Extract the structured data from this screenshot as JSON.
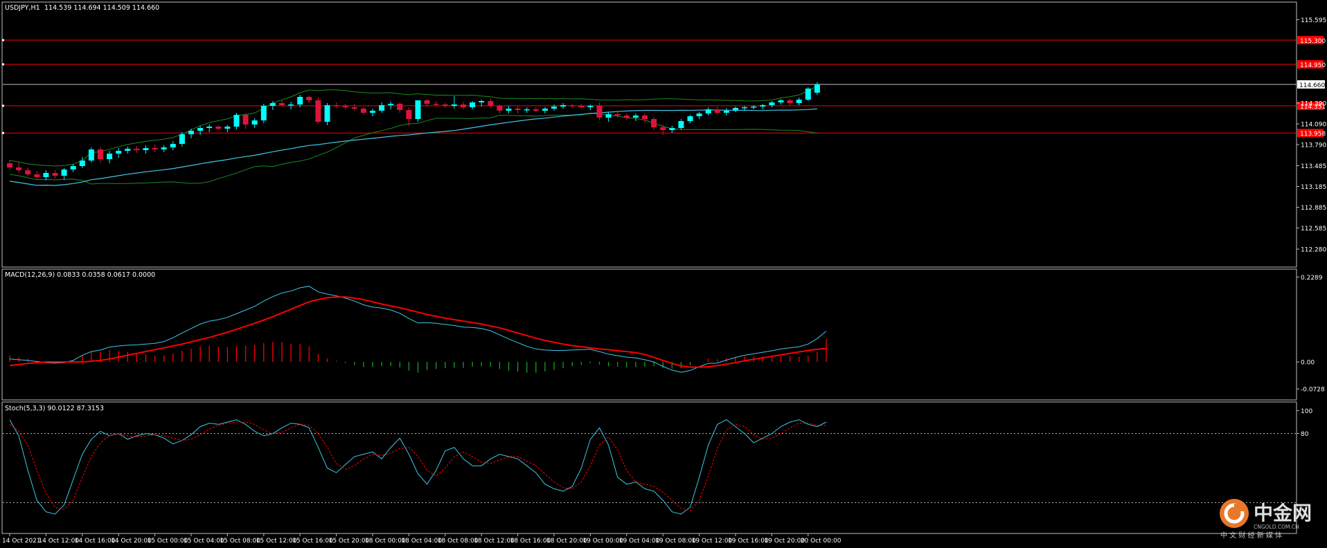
{
  "header": {
    "symbol_label": "USDJPY,H1",
    "ohlc_label": "114.539 114.694 114.509 114.660"
  },
  "colors": {
    "background": "#000000",
    "frame": "#c0c0c0",
    "bull_candle": "#00ffff",
    "bear_candle": "#dc143c",
    "moving_average": "#40c8e8",
    "bollinger_band": "#1e8c1e",
    "level_line": "#ff0000",
    "price_line": "#c0c0c0",
    "macd_line": "#40c8e8",
    "signal_line": "#ff0000",
    "hist_positive": "#ff0000",
    "hist_negative": "#1ea01e",
    "stoch_main": "#40c8e8",
    "stoch_signal": "#ff0000",
    "text": "#ffffff"
  },
  "chart_data": [
    {
      "type": "candlestick",
      "name": "USDJPY,H1",
      "ylim": [
        112.1,
        115.78
      ],
      "y_ticks": [
        "115.595",
        "114.390",
        "114.090",
        "113.790",
        "113.485",
        "113.185",
        "112.885",
        "112.585",
        "112.280"
      ],
      "current_price_label": "114.660",
      "current_price": 114.66,
      "level_labels": [
        "115.300",
        "114.950",
        "114.351",
        "113.958"
      ],
      "levels": [
        115.3,
        114.95,
        114.351,
        113.958
      ],
      "x_labels": [
        "14 Oct 2021",
        "14 Oct 12:00",
        "14 Oct 16:00",
        "14 Oct 20:00",
        "15 Oct 00:00",
        "15 Oct 04:00",
        "15 Oct 08:00",
        "15 Oct 12:00",
        "15 Oct 16:00",
        "15 Oct 20:00",
        "18 Oct 00:00",
        "18 Oct 04:00",
        "18 Oct 08:00",
        "18 Oct 12:00",
        "18 Oct 16:00",
        "18 Oct 20:00",
        "19 Oct 00:00",
        "19 Oct 04:00",
        "19 Oct 08:00",
        "19 Oct 12:00",
        "19 Oct 16:00",
        "19 Oct 20:00",
        "20 Oct 00:00"
      ],
      "candles": [
        [
          113.52,
          113.57,
          113.43,
          113.46
        ],
        [
          113.46,
          113.53,
          113.38,
          113.42
        ],
        [
          113.42,
          113.46,
          113.33,
          113.36
        ],
        [
          113.36,
          113.41,
          113.29,
          113.32
        ],
        [
          113.32,
          113.42,
          113.27,
          113.38
        ],
        [
          113.38,
          113.42,
          113.3,
          113.34
        ],
        [
          113.34,
          113.45,
          113.28,
          113.43
        ],
        [
          113.43,
          113.51,
          113.39,
          113.48
        ],
        [
          113.48,
          113.61,
          113.45,
          113.56
        ],
        [
          113.56,
          113.75,
          113.53,
          113.72
        ],
        [
          113.72,
          113.76,
          113.53,
          113.58
        ],
        [
          113.58,
          113.7,
          113.52,
          113.66
        ],
        [
          113.66,
          113.74,
          113.6,
          113.7
        ],
        [
          113.7,
          113.76,
          113.66,
          113.73
        ],
        [
          113.73,
          113.77,
          113.67,
          113.71
        ],
        [
          113.71,
          113.78,
          113.66,
          113.74
        ],
        [
          113.74,
          113.79,
          113.68,
          113.72
        ],
        [
          113.72,
          113.78,
          113.68,
          113.75
        ],
        [
          113.75,
          113.84,
          113.71,
          113.8
        ],
        [
          113.8,
          113.97,
          113.76,
          113.94
        ],
        [
          113.94,
          114.02,
          113.88,
          113.99
        ],
        [
          113.99,
          114.06,
          113.93,
          114.03
        ],
        [
          114.03,
          114.08,
          113.97,
          114.05
        ],
        [
          114.05,
          114.07,
          114.0,
          114.02
        ],
        [
          114.02,
          114.07,
          113.97,
          114.05
        ],
        [
          114.05,
          114.25,
          114.01,
          114.22
        ],
        [
          114.22,
          114.24,
          114.02,
          114.08
        ],
        [
          114.08,
          114.17,
          114.03,
          114.14
        ],
        [
          114.14,
          114.38,
          114.1,
          114.35
        ],
        [
          114.35,
          114.42,
          114.29,
          114.39
        ],
        [
          114.39,
          114.43,
          114.34,
          114.36
        ],
        [
          114.36,
          114.41,
          114.3,
          114.37
        ],
        [
          114.37,
          114.51,
          114.33,
          114.48
        ],
        [
          114.48,
          114.5,
          114.39,
          114.43
        ],
        [
          114.43,
          114.47,
          114.09,
          114.12
        ],
        [
          114.12,
          114.39,
          114.07,
          114.36
        ],
        [
          114.36,
          114.4,
          114.32,
          114.35
        ],
        [
          114.35,
          114.38,
          114.3,
          114.33
        ],
        [
          114.33,
          114.38,
          114.28,
          114.31
        ],
        [
          114.31,
          114.33,
          114.22,
          114.25
        ],
        [
          114.25,
          114.31,
          114.2,
          114.28
        ],
        [
          114.28,
          114.4,
          114.25,
          114.36
        ],
        [
          114.36,
          114.41,
          114.3,
          114.38
        ],
        [
          114.38,
          114.4,
          114.25,
          114.29
        ],
        [
          114.29,
          114.33,
          114.06,
          114.16
        ],
        [
          114.16,
          114.34,
          114.12,
          114.43
        ],
        [
          114.43,
          114.45,
          114.34,
          114.38
        ],
        [
          114.38,
          114.42,
          114.34,
          114.37
        ],
        [
          114.37,
          114.4,
          114.32,
          114.35
        ],
        [
          114.35,
          114.49,
          114.31,
          114.37
        ],
        [
          114.37,
          114.41,
          114.3,
          114.33
        ],
        [
          114.33,
          114.42,
          114.3,
          114.4
        ],
        [
          114.4,
          114.44,
          114.34,
          114.42
        ],
        [
          114.42,
          114.46,
          114.33,
          114.35
        ],
        [
          114.35,
          114.37,
          114.24,
          114.28
        ],
        [
          114.28,
          114.35,
          114.24,
          114.31
        ],
        [
          114.31,
          114.34,
          114.24,
          114.29
        ],
        [
          114.29,
          114.33,
          114.25,
          114.3
        ],
        [
          114.3,
          114.33,
          114.26,
          114.28
        ],
        [
          114.28,
          114.33,
          114.24,
          114.31
        ],
        [
          114.31,
          114.37,
          114.28,
          114.34
        ],
        [
          114.34,
          114.39,
          114.31,
          114.36
        ],
        [
          114.36,
          114.38,
          114.32,
          114.35
        ],
        [
          114.35,
          114.38,
          114.31,
          114.33
        ],
        [
          114.33,
          114.37,
          114.29,
          114.35
        ],
        [
          114.35,
          114.4,
          114.14,
          114.18
        ],
        [
          114.18,
          114.26,
          114.12,
          114.23
        ],
        [
          114.23,
          114.26,
          114.18,
          114.21
        ],
        [
          114.21,
          114.24,
          114.15,
          114.18
        ],
        [
          114.18,
          114.24,
          114.13,
          114.21
        ],
        [
          114.21,
          114.24,
          114.1,
          114.16
        ],
        [
          114.16,
          114.19,
          114.0,
          114.04
        ],
        [
          114.04,
          114.08,
          113.93,
          114.0
        ],
        [
          114.0,
          114.06,
          113.96,
          114.03
        ],
        [
          114.03,
          114.16,
          114.0,
          114.13
        ],
        [
          114.13,
          114.22,
          114.1,
          114.2
        ],
        [
          114.2,
          114.26,
          114.16,
          114.24
        ],
        [
          114.24,
          114.33,
          114.21,
          114.3
        ],
        [
          114.3,
          114.34,
          114.22,
          114.25
        ],
        [
          114.25,
          114.32,
          114.21,
          114.28
        ],
        [
          114.28,
          114.34,
          114.26,
          114.32
        ],
        [
          114.32,
          114.35,
          114.28,
          114.33
        ],
        [
          114.33,
          114.36,
          114.3,
          114.34
        ],
        [
          114.34,
          114.38,
          114.3,
          114.36
        ],
        [
          114.36,
          114.42,
          114.33,
          114.4
        ],
        [
          114.4,
          114.45,
          114.37,
          114.43
        ],
        [
          114.43,
          114.45,
          114.36,
          114.39
        ],
        [
          114.39,
          114.47,
          114.36,
          114.44
        ],
        [
          114.44,
          114.62,
          114.42,
          114.6
        ],
        [
          114.54,
          114.694,
          114.509,
          114.66
        ]
      ]
    },
    {
      "type": "line",
      "name": "MACD(12,26,9)",
      "label": "MACD(12,26,9) 0.0833 0.0358 0.0617 0.0000",
      "ylim": [
        -0.095,
        0.2389
      ],
      "y_ticks": [
        "0.2289",
        "0.00",
        "-0.0728"
      ],
      "macd": [
        0.008,
        0.006,
        0.004,
        0.001,
        -0.002,
        -0.003,
        -0.002,
        0.004,
        0.018,
        0.028,
        0.032,
        0.04,
        0.043,
        0.045,
        0.046,
        0.048,
        0.05,
        0.055,
        0.065,
        0.078,
        0.09,
        0.102,
        0.11,
        0.114,
        0.12,
        0.13,
        0.14,
        0.15,
        0.164,
        0.176,
        0.186,
        0.191,
        0.2,
        0.204,
        0.189,
        0.183,
        0.178,
        0.172,
        0.164,
        0.154,
        0.148,
        0.145,
        0.14,
        0.131,
        0.117,
        0.105,
        0.106,
        0.104,
        0.101,
        0.098,
        0.094,
        0.093,
        0.09,
        0.084,
        0.073,
        0.062,
        0.052,
        0.042,
        0.035,
        0.032,
        0.031,
        0.031,
        0.032,
        0.033,
        0.034,
        0.028,
        0.021,
        0.017,
        0.013,
        0.011,
        0.006,
        0.0,
        -0.012,
        -0.022,
        -0.028,
        -0.023,
        -0.013,
        -0.004,
        -0.003,
        0.005,
        0.012,
        0.018,
        0.022,
        0.026,
        0.03,
        0.035,
        0.038,
        0.041,
        0.048,
        0.063,
        0.083
      ],
      "signal": [
        -0.01,
        -0.007,
        -0.004,
        -0.002,
        0.0,
        0.0,
        0.0,
        0.0,
        0.0,
        0.002,
        0.004,
        0.008,
        0.013,
        0.018,
        0.023,
        0.028,
        0.033,
        0.038,
        0.043,
        0.048,
        0.054,
        0.06,
        0.066,
        0.073,
        0.08,
        0.088,
        0.096,
        0.104,
        0.113,
        0.122,
        0.132,
        0.142,
        0.152,
        0.162,
        0.168,
        0.173,
        0.175,
        0.175,
        0.172,
        0.168,
        0.162,
        0.156,
        0.151,
        0.146,
        0.14,
        0.134,
        0.128,
        0.123,
        0.118,
        0.114,
        0.11,
        0.106,
        0.102,
        0.097,
        0.092,
        0.085,
        0.078,
        0.071,
        0.064,
        0.058,
        0.053,
        0.048,
        0.044,
        0.041,
        0.038,
        0.035,
        0.033,
        0.03,
        0.028,
        0.025,
        0.02,
        0.012,
        0.004,
        -0.004,
        -0.011,
        -0.014,
        -0.014,
        -0.013,
        -0.01,
        -0.006,
        -0.002,
        0.003,
        0.007,
        0.011,
        0.015,
        0.019,
        0.023,
        0.027,
        0.031,
        0.034,
        0.036
      ],
      "histogram": [
        0.018,
        0.013,
        0.008,
        0.003,
        -0.002,
        -0.003,
        -0.002,
        0.004,
        0.018,
        0.026,
        0.028,
        0.032,
        0.03,
        0.027,
        0.023,
        0.02,
        0.017,
        0.017,
        0.022,
        0.03,
        0.036,
        0.042,
        0.044,
        0.041,
        0.04,
        0.042,
        0.044,
        0.046,
        0.051,
        0.054,
        0.054,
        0.049,
        0.048,
        0.042,
        0.021,
        0.01,
        0.003,
        -0.003,
        -0.008,
        -0.014,
        -0.014,
        -0.011,
        -0.011,
        -0.015,
        -0.023,
        -0.029,
        -0.022,
        -0.019,
        -0.017,
        -0.016,
        -0.016,
        -0.013,
        -0.012,
        -0.013,
        -0.019,
        -0.023,
        -0.026,
        -0.029,
        -0.029,
        -0.026,
        -0.022,
        -0.017,
        -0.012,
        -0.008,
        -0.004,
        -0.007,
        -0.012,
        -0.013,
        -0.015,
        -0.014,
        -0.014,
        -0.012,
        -0.016,
        -0.018,
        -0.017,
        -0.009,
        0.001,
        0.009,
        0.007,
        0.011,
        0.014,
        0.015,
        0.015,
        0.015,
        0.015,
        0.016,
        0.015,
        0.014,
        0.017,
        0.027,
        0.062
      ]
    },
    {
      "type": "line",
      "name": "Stoch(5,3,3)",
      "label": "Stoch(5,3,3) 90.0122 87.3153",
      "ylim": [
        -5,
        105
      ],
      "y_ticks": [
        "100",
        "80"
      ],
      "levels": [
        80,
        20
      ],
      "main": [
        92,
        78,
        48,
        22,
        12,
        10,
        18,
        40,
        62,
        75,
        82,
        78,
        80,
        75,
        78,
        80,
        79,
        76,
        71,
        74,
        79,
        86,
        89,
        88,
        90,
        92,
        88,
        82,
        78,
        80,
        85,
        89,
        88,
        85,
        68,
        50,
        46,
        53,
        60,
        62,
        64,
        58,
        68,
        76,
        62,
        45,
        36,
        48,
        65,
        68,
        58,
        52,
        52,
        58,
        62,
        60,
        58,
        52,
        46,
        36,
        32,
        30,
        34,
        50,
        75,
        85,
        70,
        42,
        36,
        38,
        32,
        30,
        22,
        12,
        10,
        16,
        42,
        70,
        88,
        92,
        86,
        80,
        72,
        76,
        80,
        86,
        90,
        92,
        88,
        86,
        90
      ],
      "signal": [
        88,
        82,
        70,
        48,
        28,
        16,
        14,
        22,
        42,
        60,
        72,
        78,
        80,
        78,
        77,
        78,
        79,
        78,
        76,
        74,
        75,
        79,
        84,
        87,
        89,
        90,
        90,
        88,
        83,
        80,
        81,
        85,
        88,
        87,
        80,
        68,
        54,
        49,
        52,
        58,
        62,
        61,
        63,
        67,
        68,
        60,
        48,
        43,
        50,
        60,
        64,
        60,
        55,
        54,
        57,
        60,
        60,
        56,
        52,
        45,
        38,
        33,
        32,
        38,
        52,
        70,
        77,
        66,
        48,
        38,
        36,
        34,
        29,
        22,
        15,
        13,
        22,
        43,
        67,
        83,
        88,
        86,
        79,
        75,
        76,
        80,
        85,
        89,
        89,
        87,
        87
      ]
    }
  ],
  "watermark": {
    "brand_cn": "中金网",
    "brand_url": "CNGOLD.COM.CN",
    "slogan": "中 文 财 经 新 媒 体"
  }
}
